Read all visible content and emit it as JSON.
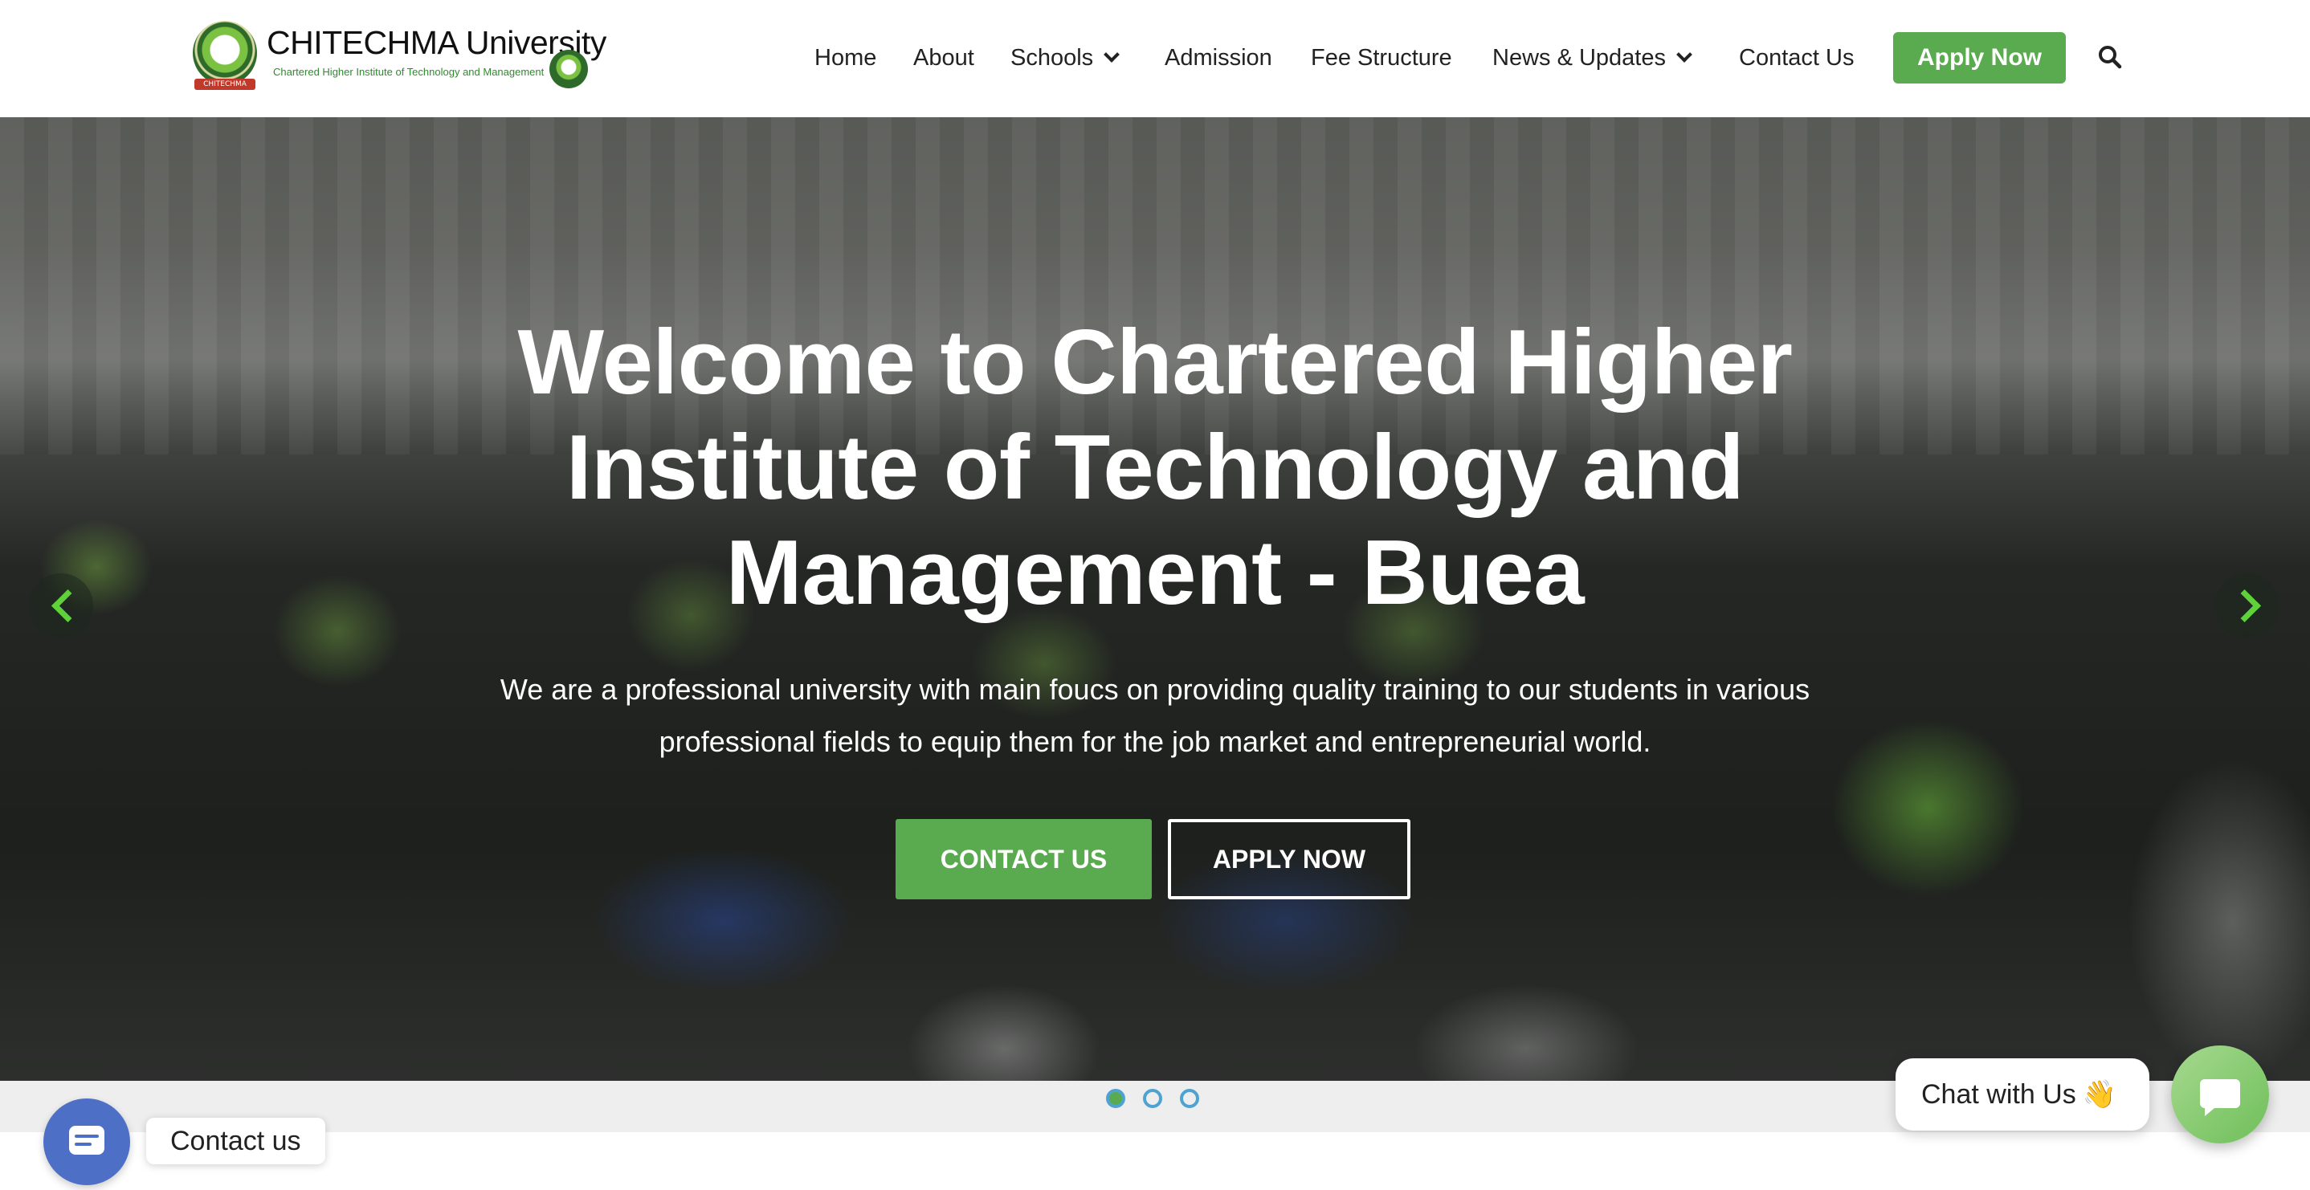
{
  "brand": {
    "name": "CHITECHMA University",
    "tagline": "Chartered Higher Institute of Technology and Management",
    "ribbon": "CHITECHMA"
  },
  "nav": {
    "home": "Home",
    "about": "About",
    "schools": "Schools",
    "admission": "Admission",
    "fee_structure": "Fee Structure",
    "news": "News & Updates",
    "contact": "Contact Us",
    "apply": "Apply Now"
  },
  "hero": {
    "title": "Welcome to Chartered Higher Institute of Technology and Management - Buea",
    "text": "We are a professional university with main foucs on providing quality training to our students in various professional fields to equip them for the job market and entrepreneurial world.",
    "contact_button": "CONTACT US",
    "apply_button": "APPLY NOW"
  },
  "slider": {
    "active_slide": 1,
    "slide_count": 3
  },
  "widgets": {
    "contact_label": "Contact us",
    "chat_label": "Chat with Us",
    "chat_emoji": "👋"
  },
  "colors": {
    "accent_green": "#5aab4f",
    "dot_blue": "#4fa3d0",
    "contact_blue": "#4d6fc6"
  },
  "icons": [
    "search-icon",
    "chevron-down-icon",
    "chevron-left-icon",
    "chevron-right-icon",
    "message-icon",
    "chat-icon"
  ]
}
